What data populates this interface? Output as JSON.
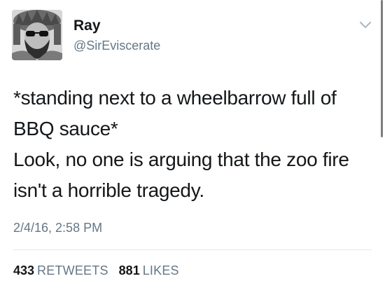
{
  "author": {
    "name": "Ray",
    "handle": "@SirEviscerate"
  },
  "tweet": {
    "lines": [
      "*standing next to a wheelbarrow full of",
      "BBQ sauce*",
      "Look, no one is arguing that the zoo fire",
      "isn't a horrible tragedy."
    ],
    "timestamp": "2/4/16, 2:58 PM"
  },
  "stats": {
    "retweets": {
      "count": "433",
      "label": "RETWEETS"
    },
    "likes": {
      "count": "881",
      "label": "LIKES"
    }
  },
  "icons": {
    "menu": "chevron-down-icon",
    "avatar": "avatar"
  },
  "colors": {
    "text": "#14171a",
    "secondary": "#657786",
    "divider": "#e1e8ed",
    "background": "#ffffff"
  }
}
